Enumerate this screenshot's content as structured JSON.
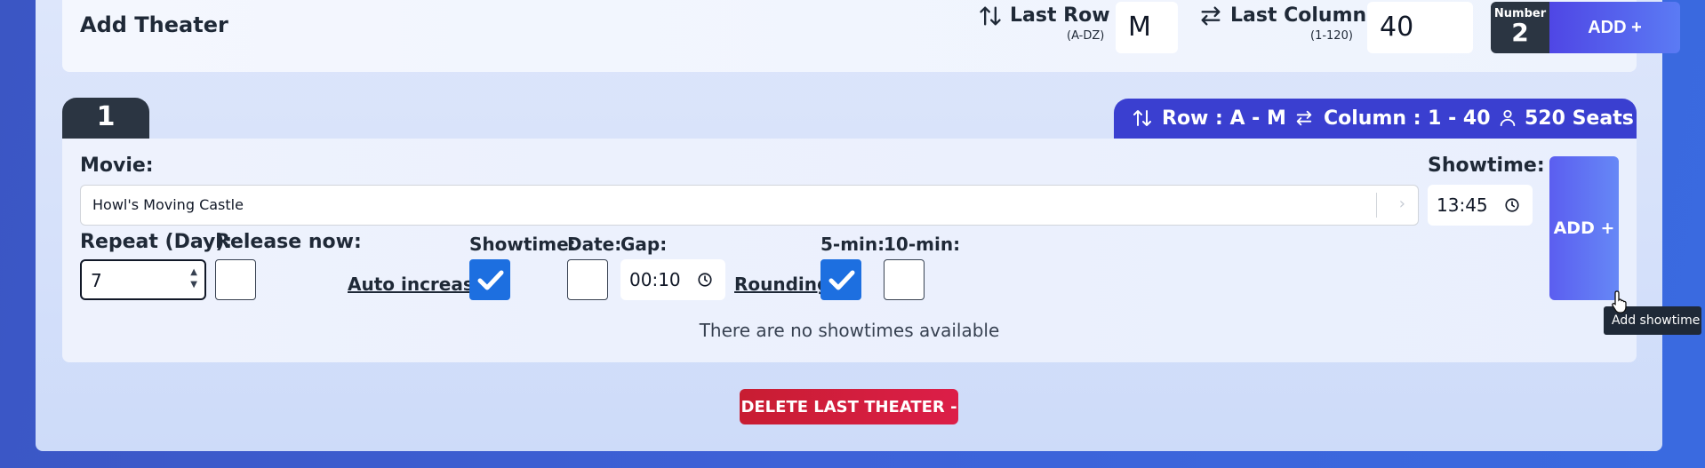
{
  "header": {
    "title": "Add Theater",
    "last_row_label": "Last Row :",
    "last_row_hint": "(A-DZ)",
    "last_row_value": "M",
    "last_column_label": "Last Column :",
    "last_column_hint": "(1-120)",
    "last_column_value": "40",
    "number_label": "Number",
    "number_value": "2",
    "add_label": "ADD +"
  },
  "theater": {
    "number": "1",
    "row_info": "Row : A - M",
    "column_info": "Column : 1 - 40",
    "seats_info": "520 Seats",
    "movie_label": "Movie:",
    "movie_value": "Howl's Moving Castle",
    "showtime_label": "Showtime:",
    "showtime_value": "13:45",
    "repeat_label": "Repeat (Day):",
    "repeat_value": "7",
    "release_label": "Release now:",
    "auto_increase_label": "Auto increase",
    "showtime_check_label": "Showtime:",
    "date_label": "Date:",
    "gap_label": "Gap:",
    "gap_value": "00:10",
    "rounding_label": "Rounding",
    "five_min_label": "5-min:",
    "ten_min_label": "10-min:",
    "empty_message": "There are no showtimes available",
    "add_showtime_label": "ADD +",
    "tooltip": "Add showtime",
    "checks": {
      "release_now": false,
      "showtime": true,
      "date": false,
      "five_min": true,
      "ten_min": false
    }
  },
  "footer": {
    "delete_label": "DELETE LAST THEATER -"
  },
  "icons": [
    "sort-vertical-icon",
    "swap-horizontal-icon",
    "clock-icon",
    "user-icon",
    "chevron-right-icon",
    "pointer-cursor-icon"
  ],
  "colors": {
    "accent": "#3a3fd0",
    "dark": "#2b3542",
    "checked": "#1d6fe0",
    "danger": "#c81d32"
  }
}
